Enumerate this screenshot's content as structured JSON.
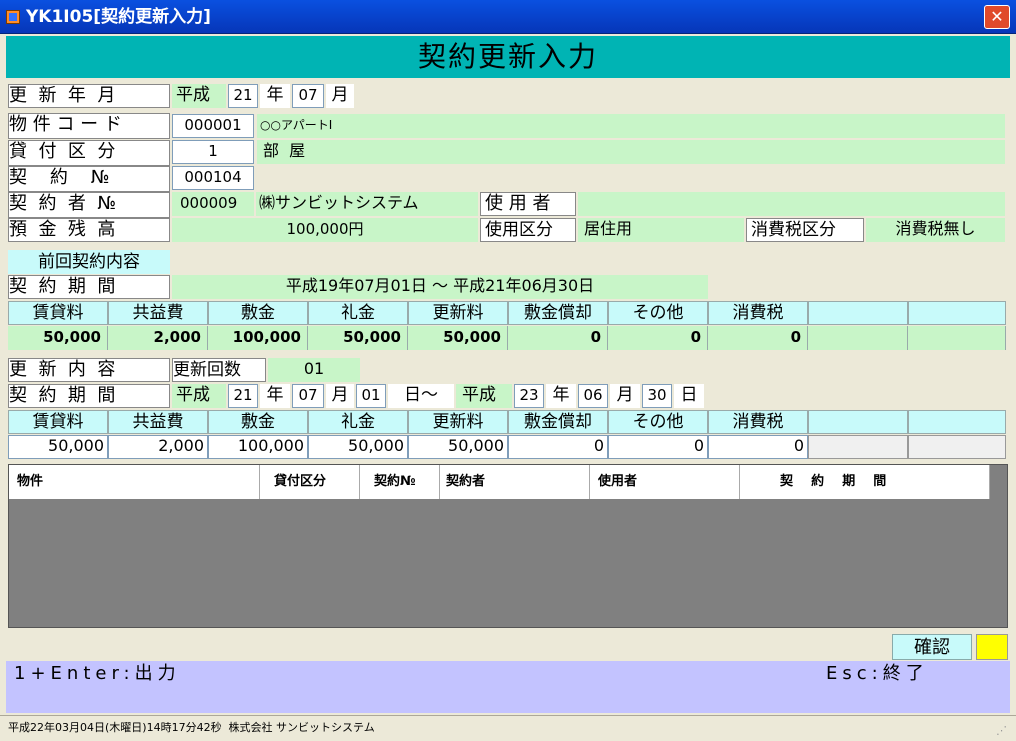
{
  "window": {
    "title": "YK1I05[契約更新入力]",
    "close_label": "✕"
  },
  "header": {
    "title": "契約更新入力"
  },
  "renewal_month": {
    "label": "更  新  年  月",
    "era": "平成",
    "year": "21",
    "year_unit": "年",
    "month": "07",
    "month_unit": "月"
  },
  "property": {
    "label": "物 件 コ ー ド",
    "code": "000001",
    "name": "○○アパートI"
  },
  "lease_type": {
    "label": "貸  付  区  分",
    "code": "1",
    "name": "部  屋"
  },
  "contract": {
    "label": "契    約    №",
    "number": "000104"
  },
  "contractor": {
    "label": "契  約  者  №",
    "number": "000009",
    "name": "㈱サンビットシステム",
    "user_label": "使 用 者",
    "user_value": ""
  },
  "deposit": {
    "label": "預  金  残  高",
    "value": "100,000円",
    "usage_label": "使用区分",
    "usage_value": "居住用",
    "tax_label": "消費税区分",
    "tax_value": "消費税無し"
  },
  "prev": {
    "title": "前回契約内容",
    "period_label": "契  約  期  間",
    "period_value": "平成19年07月01日 ～ 平成21年06月30日",
    "headers": [
      "賃貸料",
      "共益費",
      "敷金",
      "礼金",
      "更新料",
      "敷金償却",
      "その他",
      "消費税",
      "",
      ""
    ],
    "values": [
      "50,000",
      "2,000",
      "100,000",
      "50,000",
      "50,000",
      "0",
      "0",
      "0",
      "",
      ""
    ]
  },
  "renew": {
    "label": "更  新  内  容",
    "count_label": "更新回数",
    "count_value": "01",
    "period_label": "契  約  期  間",
    "from_era": "平成",
    "from_year": "21",
    "year_unit": "年",
    "from_month": "07",
    "month_unit": "月",
    "from_day": "01",
    "day_sep": "日～",
    "to_era": "平成",
    "to_year": "23",
    "to_month": "06",
    "to_day": "30",
    "day_unit": "日",
    "headers": [
      "賃貸料",
      "共益費",
      "敷金",
      "礼金",
      "更新料",
      "敷金償却",
      "その他",
      "消費税",
      "",
      ""
    ],
    "values": [
      "50,000",
      "2,000",
      "100,000",
      "50,000",
      "50,000",
      "0",
      "0",
      "0",
      "",
      ""
    ]
  },
  "grid": {
    "columns": [
      "物件",
      "貸付区分",
      "契約№",
      "契約者",
      "使用者",
      "契    約    期    間"
    ]
  },
  "confirm": {
    "label": "確認"
  },
  "footer": {
    "left": "1+Enter:出力",
    "right": "Esc:終了"
  },
  "status": {
    "text": "平成22年03月04日(木曜日)14時17分42秒  株式会社 サンビットシステム"
  },
  "colors": {
    "titlebar": "#0A3FC8",
    "header": "#00B4B4",
    "field_green": "#C8F5C8",
    "col_header": "#C8FAFA",
    "footer_bar": "#C3C3FF",
    "grid_bg": "#808080",
    "confirm_indicator": "#FFFF00"
  }
}
